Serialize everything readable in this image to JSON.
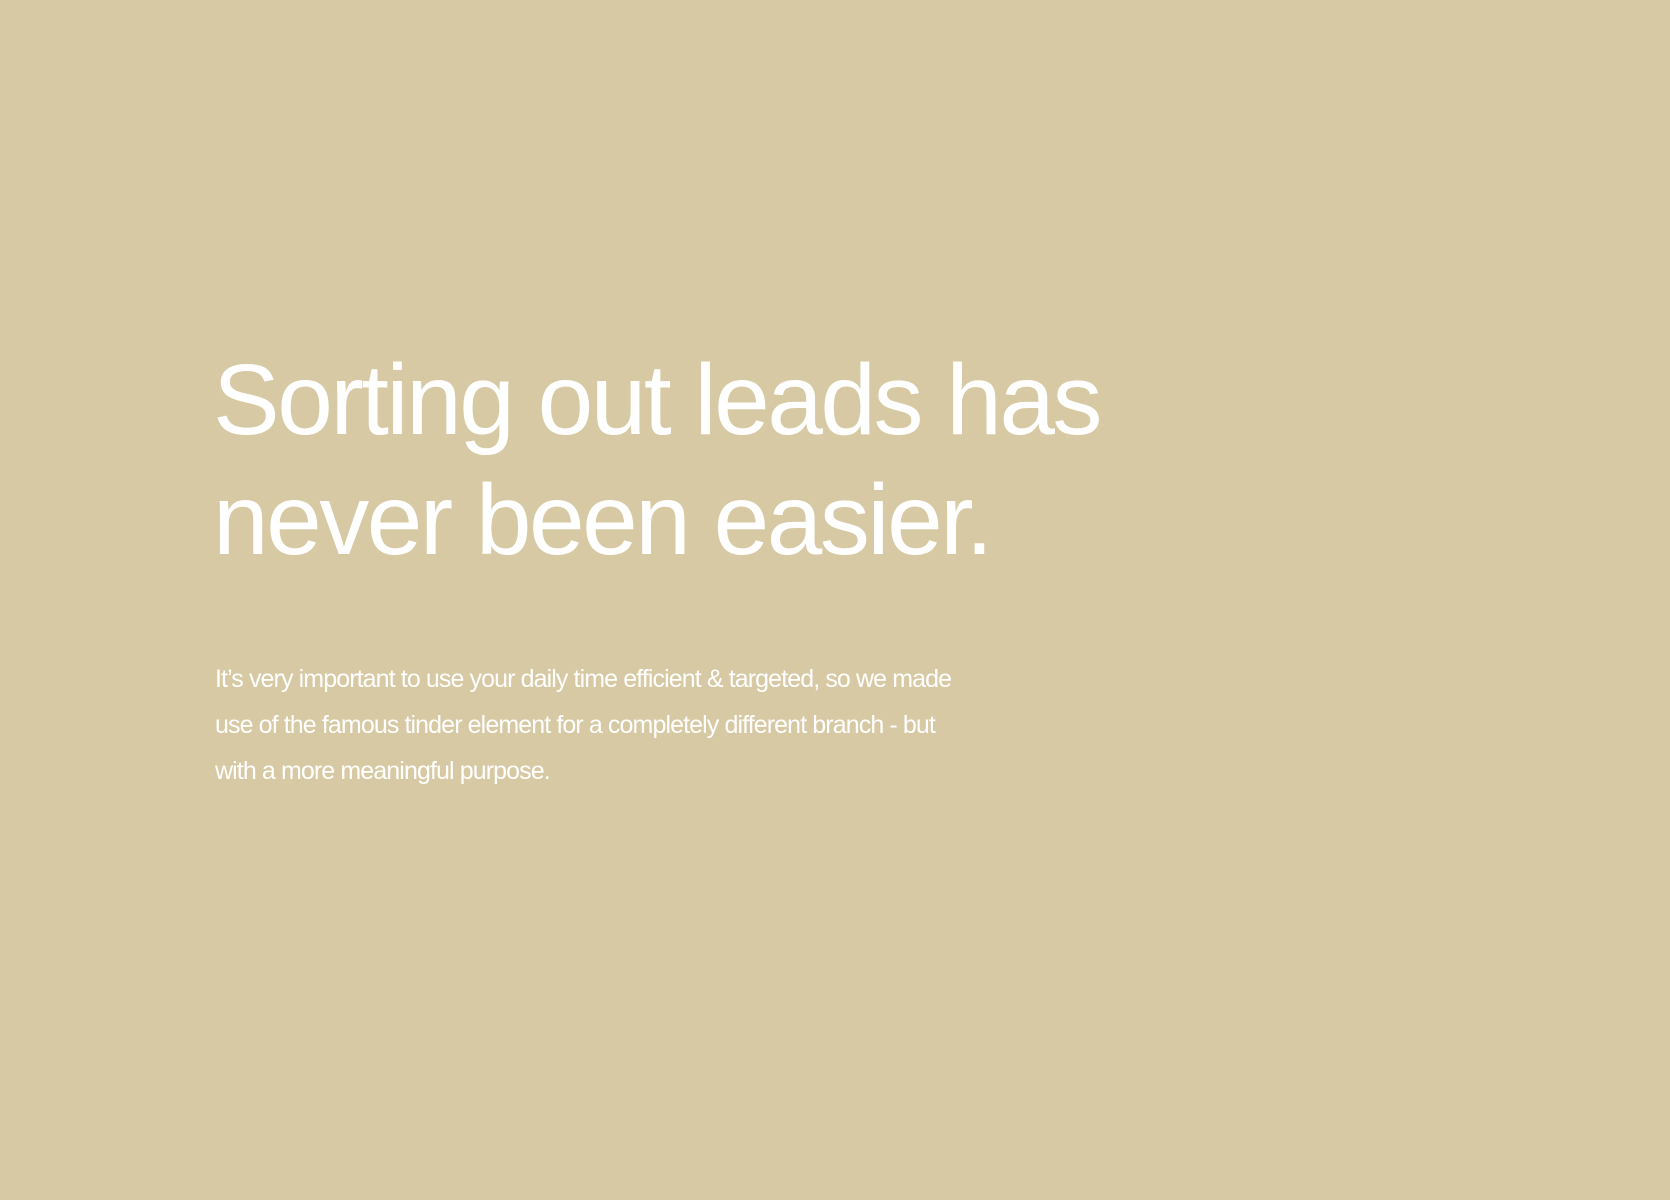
{
  "hero": {
    "headline_lines": [
      "Sorting out leads has",
      "never been easier."
    ],
    "body_lines": [
      "It’s very important to use your daily time efficient & targeted, so we made",
      "use of the famous tinder element for a completely different branch - but",
      "with a more meaningful purpose."
    ]
  },
  "colors": {
    "background": "#d7c9a3",
    "text": "#ffffff"
  }
}
